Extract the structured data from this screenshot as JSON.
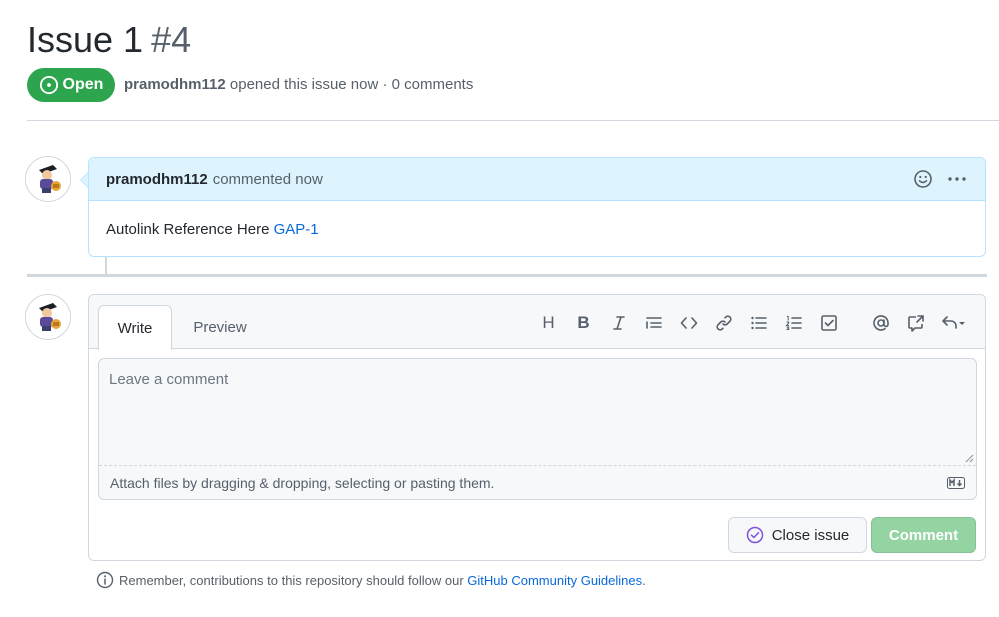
{
  "issue": {
    "title": "Issue 1",
    "number": "#4",
    "state": "Open",
    "author": "pramodhm112",
    "meta_text": "opened this issue now · 0 comments"
  },
  "comment": {
    "author": "pramodhm112",
    "time_text": "commented now",
    "body_text": "Autolink Reference Here ",
    "body_link": "GAP-1",
    "icons": [
      "smiley-icon",
      "kebab-menu-icon"
    ]
  },
  "editor": {
    "tabs": [
      "Write",
      "Preview"
    ],
    "active_tab": "Write",
    "placeholder": "Leave a comment",
    "attach_text": "Attach files by dragging & dropping, selecting or pasting them.",
    "toolbar": {
      "heading": "H",
      "bold": "B",
      "icons": [
        "italic-icon",
        "quote-icon",
        "code-icon",
        "link-icon",
        "bulleted-list-icon",
        "numbered-list-icon",
        "task-list-icon",
        "mention-icon",
        "cross-reference-icon",
        "reply-icon"
      ]
    },
    "close_label": "Close issue",
    "comment_label": "Comment"
  },
  "footer": {
    "text": "Remember, contributions to this repository should follow our ",
    "link": "GitHub Community Guidelines",
    "suffix": "."
  },
  "colors": {
    "open_green": "#2da44e",
    "link_blue": "#0969da",
    "header_blue": "#ddf4ff",
    "comment_button_disabled": "#94d3a2"
  }
}
